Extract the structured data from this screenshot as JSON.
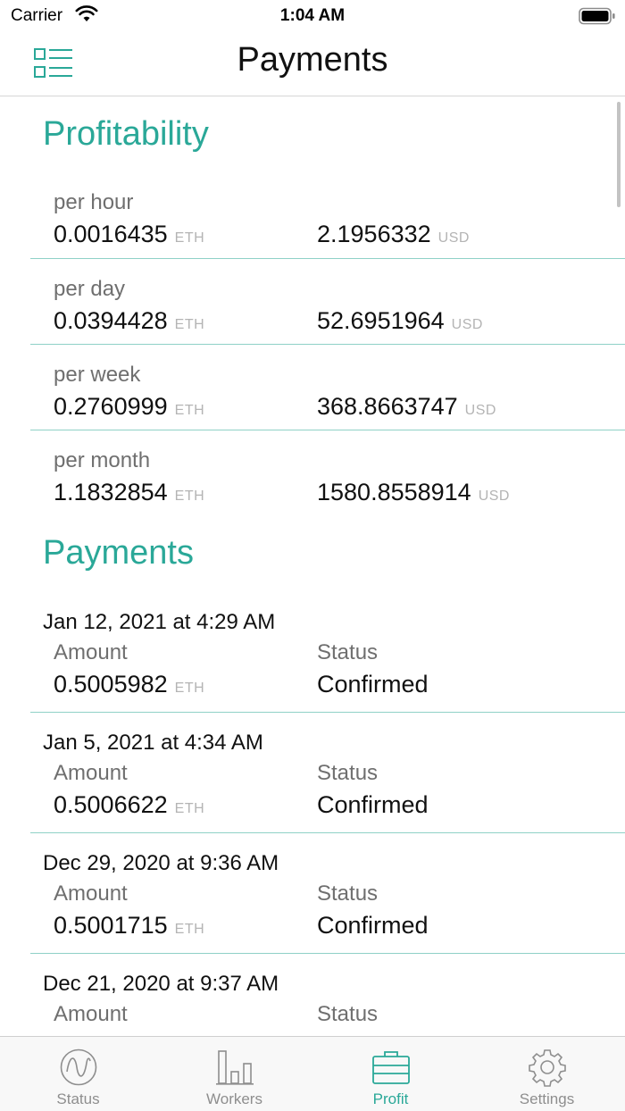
{
  "status_bar": {
    "carrier": "Carrier",
    "time": "1:04 AM"
  },
  "nav": {
    "title": "Payments",
    "menu_icon": "list-menu-icon"
  },
  "colors": {
    "accent": "#2aa898",
    "divider": "#8fd1c7",
    "muted": "#8e8e8e"
  },
  "profitability": {
    "title": "Profitability",
    "rows": [
      {
        "label": "per hour",
        "eth": "0.0016435",
        "eth_unit": "ETH",
        "usd": "2.1956332",
        "usd_unit": "USD"
      },
      {
        "label": "per day",
        "eth": "0.0394428",
        "eth_unit": "ETH",
        "usd": "52.6951964",
        "usd_unit": "USD"
      },
      {
        "label": "per week",
        "eth": "0.2760999",
        "eth_unit": "ETH",
        "usd": "368.8663747",
        "usd_unit": "USD"
      },
      {
        "label": "per month",
        "eth": "1.1832854",
        "eth_unit": "ETH",
        "usd": "1580.8558914",
        "usd_unit": "USD"
      }
    ]
  },
  "payments": {
    "title": "Payments",
    "items": [
      {
        "date": "Jan 12, 2021 at 4:29 AM",
        "amount_label": "Amount",
        "amount": "0.5005982",
        "unit": "ETH",
        "status_label": "Status",
        "status": "Confirmed"
      },
      {
        "date": "Jan 5, 2021 at 4:34 AM",
        "amount_label": "Amount",
        "amount": "0.5006622",
        "unit": "ETH",
        "status_label": "Status",
        "status": "Confirmed"
      },
      {
        "date": "Dec 29, 2020 at 9:36 AM",
        "amount_label": "Amount",
        "amount": "0.5001715",
        "unit": "ETH",
        "status_label": "Status",
        "status": "Confirmed"
      },
      {
        "date": "Dec 21, 2020 at 9:37 AM",
        "amount_label": "Amount",
        "status_label": "Status"
      }
    ]
  },
  "tabs": [
    {
      "label": "Status",
      "icon": "status-wave-icon",
      "active": false
    },
    {
      "label": "Workers",
      "icon": "workers-bar-chart-icon",
      "active": false
    },
    {
      "label": "Profit",
      "icon": "profit-briefcase-icon",
      "active": true
    },
    {
      "label": "Settings",
      "icon": "settings-gear-icon",
      "active": false
    }
  ]
}
